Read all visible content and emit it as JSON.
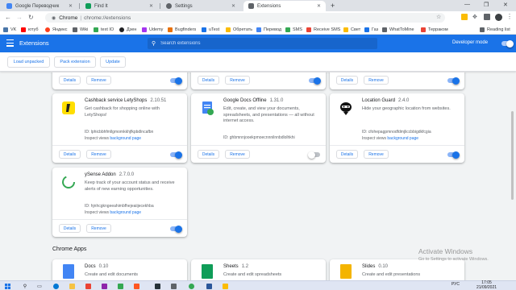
{
  "browser": {
    "tabs": [
      {
        "title": "Google Переводчик",
        "color": "#4285f4",
        "active": false
      },
      {
        "title": "Find It",
        "color": "#0f9d58",
        "active": false
      },
      {
        "title": "Settings",
        "color": "#5f6368",
        "active": false
      },
      {
        "title": "Extensions",
        "color": "#5f6368",
        "active": true
      }
    ],
    "new_tab_icon": "plus-icon",
    "url_host": "Chrome",
    "url_path": "chrome://extensions",
    "bookmarks": [
      {
        "label": "VK",
        "color": "#4a76a8"
      },
      {
        "label": "ютуб",
        "color": "#ff0000"
      },
      {
        "label": "Яндекс",
        "color": "#fc3f1d"
      },
      {
        "label": "Wiki",
        "color": "#5f6368"
      },
      {
        "label": "text IO",
        "color": "#34a853"
      },
      {
        "label": "Дзен",
        "color": "#202124"
      },
      {
        "label": "Udemy",
        "color": "#a435f0"
      },
      {
        "label": "Bugfinders",
        "color": "#e8710a"
      },
      {
        "label": "uTest",
        "color": "#1a73e8"
      },
      {
        "label": "Обретать",
        "color": "#fbbc04"
      },
      {
        "label": "Перевод",
        "color": "#4285f4"
      },
      {
        "label": "SMS",
        "color": "#34a853"
      },
      {
        "label": "Receive SMS",
        "color": "#ea4335"
      },
      {
        "label": "Свет",
        "color": "#fbbc04"
      },
      {
        "label": "Газ",
        "color": "#1a73e8"
      },
      {
        "label": "WhatToMine",
        "color": "#5f6368"
      },
      {
        "label": "Терраком",
        "color": "#ea4335"
      }
    ],
    "reading_list": "Reading list"
  },
  "header": {
    "title": "Extensions",
    "search_placeholder": "Search extensions",
    "dev_mode_label": "Developer mode",
    "dev_mode_on": true
  },
  "dev_actions": {
    "load_unpacked": "Load unpacked",
    "pack_extension": "Pack extension",
    "update": "Update"
  },
  "card_buttons": {
    "details": "Details",
    "remove": "Remove"
  },
  "top_cards": [
    {
      "enabled": true
    },
    {
      "enabled": true
    },
    {
      "enabled": true
    }
  ],
  "extensions": [
    {
      "name": "Cashback service LetyShops",
      "version": "2.10.51",
      "description": "Get cashback for shopping online with LetyShops!",
      "id": "ID: lphicbbhfmllgmomkkhjfkpbdlncafbn",
      "inspect_label": "Inspect views",
      "inspect_link": "background page",
      "enabled": true,
      "icon": "letyshops-icon"
    },
    {
      "name": "Google Docs Offline",
      "version": "1.31.0",
      "description": "Edit, create, and view your documents, spreadsheets, and presentations — all without internet access.",
      "id": "ID: ghbmnnjooekpmoecnnnilnnbdlolhkhi",
      "inspect_label": "",
      "inspect_link": "",
      "enabled": false,
      "icon": "google-docs-offline-icon"
    },
    {
      "name": "Location Guard",
      "version": "2.4.0",
      "description": "Hide your geographic location from websites.",
      "id": "ID: cfohepagpmnodfdmjliccbbigdkfcgia",
      "inspect_label": "Inspect views",
      "inspect_link": "background page",
      "enabled": true,
      "icon": "location-guard-icon"
    },
    {
      "name": "ySense Addon",
      "version": "2.7.0.0",
      "description": "Keep track of your account status and receive alerts of new earning opportunities.",
      "id": "ID: hjnhcgkngeeahimbfhejeaiijecekhba",
      "inspect_label": "Inspect views",
      "inspect_link": "background page",
      "enabled": true,
      "icon": "ysense-icon"
    }
  ],
  "chrome_apps_heading": "Chrome Apps",
  "apps": [
    {
      "name": "Docs",
      "version": "0.10",
      "description": "Create and edit documents",
      "icon": "docs-icon",
      "color": "#4285f4"
    },
    {
      "name": "Sheets",
      "version": "1.2",
      "description": "Create and edit spreadsheets",
      "icon": "sheets-icon",
      "color": "#0f9d58"
    },
    {
      "name": "Slides",
      "version": "0.10",
      "description": "Create and edit presentations",
      "icon": "slides-icon",
      "color": "#f4b400"
    }
  ],
  "watermark": {
    "line1": "Activate Windows",
    "line2": "Go to Settings to activate Windows."
  },
  "taskbar": {
    "lang": "РУС",
    "time": "17:05",
    "date": "21/09/2021"
  }
}
